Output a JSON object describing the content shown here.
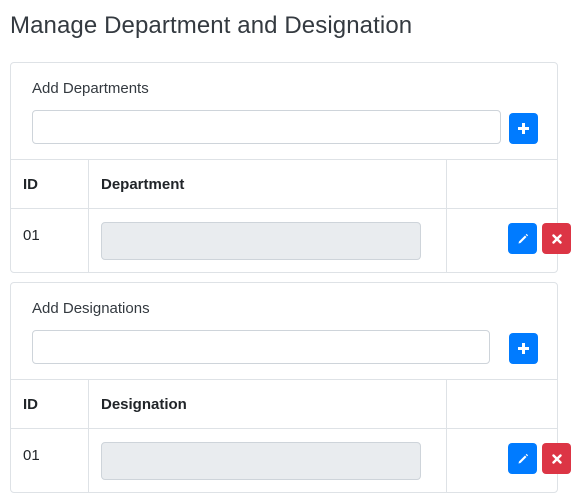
{
  "page": {
    "title": "Manage Department and Designation"
  },
  "departments": {
    "add_label": "Add Departments",
    "input_value": "",
    "headers": [
      "ID",
      "Department",
      ""
    ],
    "rows": [
      {
        "id": "01",
        "name": ""
      }
    ]
  },
  "designations": {
    "add_label": "Add Designations",
    "input_value": "",
    "headers": [
      "ID",
      "Designation",
      ""
    ],
    "rows": [
      {
        "id": "01",
        "name": ""
      }
    ]
  },
  "icons": {
    "add": "plus-icon",
    "edit": "pencil-icon",
    "delete": "times-icon"
  },
  "colors": {
    "primary": "#007bff",
    "danger": "#dc3545"
  }
}
